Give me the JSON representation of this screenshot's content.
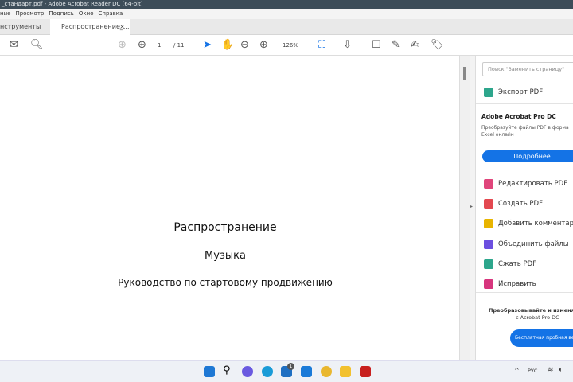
{
  "window": {
    "title": "_стандарт.pdf - Adobe Acrobat Reader DC (64-bit)"
  },
  "menu": [
    "ние",
    "Просмотр",
    "Подпись",
    "Окно",
    "Справка"
  ],
  "tabs": {
    "tools": "нструменты",
    "document": "Распространение_...",
    "close": "×"
  },
  "toolbar": {
    "page_current": "1",
    "page_total": "/ 11",
    "zoom": "126%"
  },
  "document": {
    "title": "Распространение",
    "subtitle": "Музыка",
    "heading": "Руководство по стартовому продвижению"
  },
  "pane": {
    "search_placeholder": "Поиск \"Заменить страницу\"",
    "export": "Экспорт PDF",
    "promo_title": "Adobe Acrobat Pro DC",
    "promo_text1": "Преобразуйте файлы PDF в форма",
    "promo_text2": "Excel онлайн",
    "more_button": "Подробнее",
    "tools": [
      {
        "label": "Редактировать PDF",
        "color": "#e0457b"
      },
      {
        "label": "Создать PDF",
        "color": "#e34850"
      },
      {
        "label": "Добавить комментари",
        "color": "#e8b400"
      },
      {
        "label": "Объединить файлы",
        "color": "#6c4fe0"
      },
      {
        "label": "Сжать PDF",
        "color": "#2da68c"
      },
      {
        "label": "Исправить",
        "color": "#d7357d"
      }
    ],
    "bottom_text1": "Преобразовывайте и изменяй",
    "bottom_text2": "с Acrobat Pro DC",
    "trial_button": "Бесплатная пробная ве"
  },
  "taskbar": {
    "lang": "РУС",
    "mail_badge": "1"
  }
}
